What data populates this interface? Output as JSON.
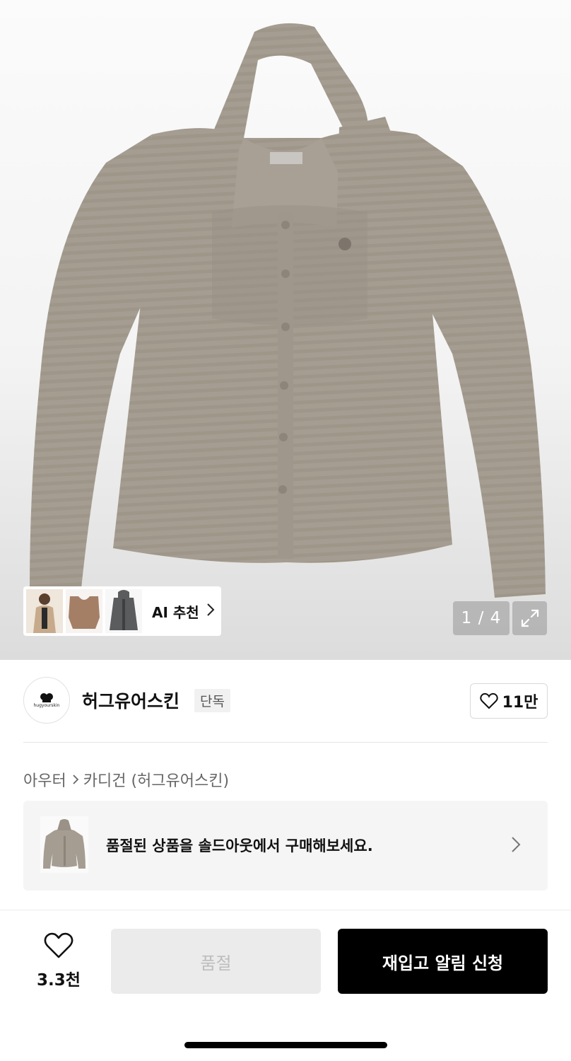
{
  "gallery": {
    "image_alt": "",
    "counter": "1 / 4",
    "ai_label": "AI 추천",
    "icons": {
      "expand": "expand-icon",
      "chevron": "chevron-right-icon"
    }
  },
  "brand": {
    "name": "허그유어스킨",
    "badge": "단독",
    "logo_text": "hugyourskin",
    "likes": "11만"
  },
  "breadcrumb": {
    "category": "아우터",
    "subcategory": "카디건 (허그유어스킨)"
  },
  "soldout_banner": {
    "text": "품절된 상품을 솔드아웃에서 구매해보세요."
  },
  "bottom_bar": {
    "wish_count": "3.3천",
    "soldout_label": "품절",
    "restock_label": "재입고 알림 신청"
  },
  "colors": {
    "garment": "#a49c90",
    "primary_button": "#000000",
    "disabled_button": "#ebebeb"
  }
}
